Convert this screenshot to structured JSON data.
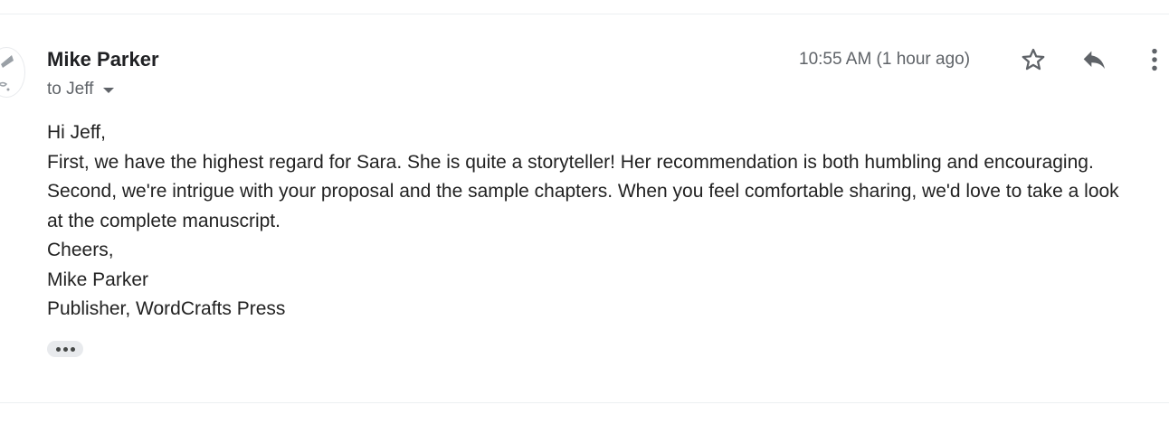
{
  "message": {
    "sender_name": "Mike Parker",
    "recipient_label": "to Jeff",
    "timestamp": "10:55 AM (1 hour ago)",
    "body_lines": [
      "Hi Jeff,",
      "First, we have the highest regard for Sara. She is quite a storyteller! Her recommendation is both humbling and encouraging.",
      "Second, we're intrigue with your proposal and the sample chapters. When you feel comfortable sharing, we'd love to take a look",
      "at the complete manuscript.",
      "Cheers,",
      "Mike Parker",
      "Publisher, WordCrafts Press"
    ]
  },
  "icons": {
    "star": "star-outline-icon",
    "reply": "reply-arrow-icon",
    "more": "more-vertical-icon",
    "caret": "chevron-down-icon",
    "ellipsis": "ellipsis-icon"
  },
  "colors": {
    "text_primary": "#202124",
    "text_secondary": "#5f6368",
    "icon": "#5f6368",
    "divider": "#eceff1",
    "chip_background": "#e8eaed"
  }
}
